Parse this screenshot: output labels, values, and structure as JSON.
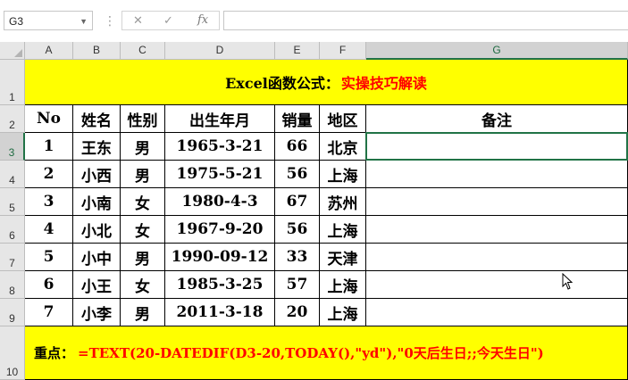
{
  "formula_bar": {
    "name_box": "G3",
    "fx_label": "fx",
    "cancel_glyph": "✕",
    "enter_glyph": "✓",
    "formula": ""
  },
  "columns": [
    "A",
    "B",
    "C",
    "D",
    "E",
    "F",
    "G"
  ],
  "rows": [
    "1",
    "2",
    "3",
    "4",
    "5",
    "6",
    "7",
    "8",
    "9",
    "10"
  ],
  "selected_cell": "G3",
  "title": {
    "black": "Excel函数公式：",
    "red": "实操技巧解读"
  },
  "table": {
    "headers": [
      "No",
      "姓名",
      "性别",
      "出生年月",
      "销量",
      "地区",
      "备注"
    ],
    "rows": [
      [
        "1",
        "王东",
        "男",
        "1965-3-21",
        "66",
        "北京",
        ""
      ],
      [
        "2",
        "小西",
        "男",
        "1975-5-21",
        "56",
        "上海",
        ""
      ],
      [
        "3",
        "小南",
        "女",
        "1980-4-3",
        "67",
        "苏州",
        ""
      ],
      [
        "4",
        "小北",
        "女",
        "1967-9-20",
        "56",
        "上海",
        ""
      ],
      [
        "5",
        "小中",
        "男",
        "1990-09-12",
        "33",
        "天津",
        ""
      ],
      [
        "6",
        "小王",
        "女",
        "1985-3-25",
        "57",
        "上海",
        ""
      ],
      [
        "7",
        "小李",
        "男",
        "2011-3-18",
        "20",
        "上海",
        ""
      ]
    ]
  },
  "note": {
    "label": "重点：",
    "formula": "=TEXT(20-DATEDIF(D3-20,TODAY(),\"yd\"),\"0天后生日;;今天生日\")"
  },
  "colors": {
    "highlight": "#ffff00",
    "accent_red": "#ff0000",
    "excel_green": "#217346"
  }
}
